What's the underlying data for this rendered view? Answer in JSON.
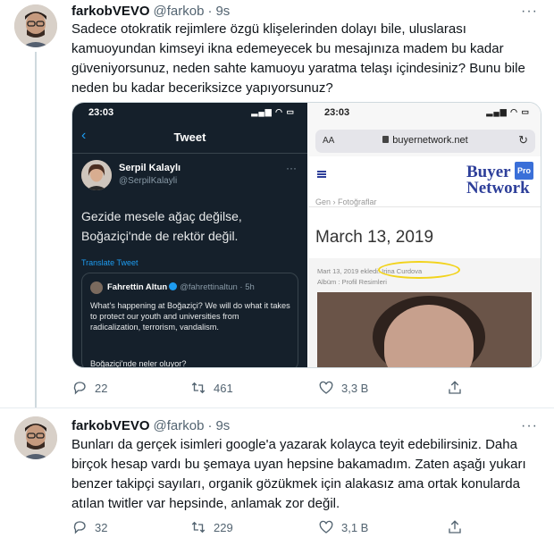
{
  "tweets": [
    {
      "display_name": "farkobVEVO",
      "handle": "@farkob",
      "separator": "·",
      "time": "9s",
      "more": "···",
      "text": "Sadece otokratik rejimlere özgü klişelerinden dolayı bile, uluslarası kamuoyundan kimseyi ikna edemeyecek bu mesajınıza madem bu kadar güveniyorsunuz, neden sahte kamuoyu yaratma telaşı içindesiniz? Bunu bile neden bu kadar beceriksizce yapıyorsunuz?",
      "replies": "22",
      "retweets": "461",
      "likes": "3,3 B"
    },
    {
      "display_name": "farkobVEVO",
      "handle": "@farkob",
      "separator": "·",
      "time": "9s",
      "more": "···",
      "text": "Bunları da gerçek isimleri google'a yazarak kolayca teyit edebilirsiniz. Daha birçok hesap vardı bu şemaya uyan hepsine bakamadım. Zaten aşağı yukarı benzer takipçi sayıları, organik gözükmek için alakasız ama ortak konularda atılan twitler var hepsinde, anlamak zor değil.",
      "replies": "32",
      "retweets": "229",
      "likes": "3,1 B"
    }
  ],
  "media": {
    "left": {
      "clock": "23:03",
      "back": "‹",
      "title": "Tweet",
      "author_name": "Serpil Kalaylı",
      "author_handle": "@SerpilKalayli",
      "more": "···",
      "tweet_text": "Gezide mesele ağaç değilse, Boğaziçi'nde de rektör değil.",
      "translate": "Translate Tweet",
      "quote_name": "Fahrettin Altun",
      "quote_handle": "@fahrettinaltun · 5h",
      "quote_text": "What's happening at Boğaziçi? We will do what it takes to protect our youth and universities from radicalization, terrorism, vandalism.",
      "quote_text_2": "Boğaziçi'nde neler oluyor?"
    },
    "right": {
      "clock": "23:03",
      "aa": "AA",
      "url": "buyernetwork.net",
      "reload": "↻",
      "logo_line1": "Buyer",
      "logo_pro": "Pro",
      "logo_line2": "Network",
      "crumb": "Gen  ›  Fotoğraflar",
      "date": "March 13, 2019",
      "meta1": "Mart 13, 2019 ekledi: Irina Curdova",
      "meta2": "Albüm : Profil Resimleri"
    }
  },
  "colors": {
    "accent": "#1d9bf0",
    "text": "#0f1419",
    "muted": "#536471",
    "dark_bg": "#15202b",
    "highlight": "#f2d31b"
  },
  "icons": [
    "reply-icon",
    "retweet-icon",
    "like-icon",
    "share-icon"
  ]
}
